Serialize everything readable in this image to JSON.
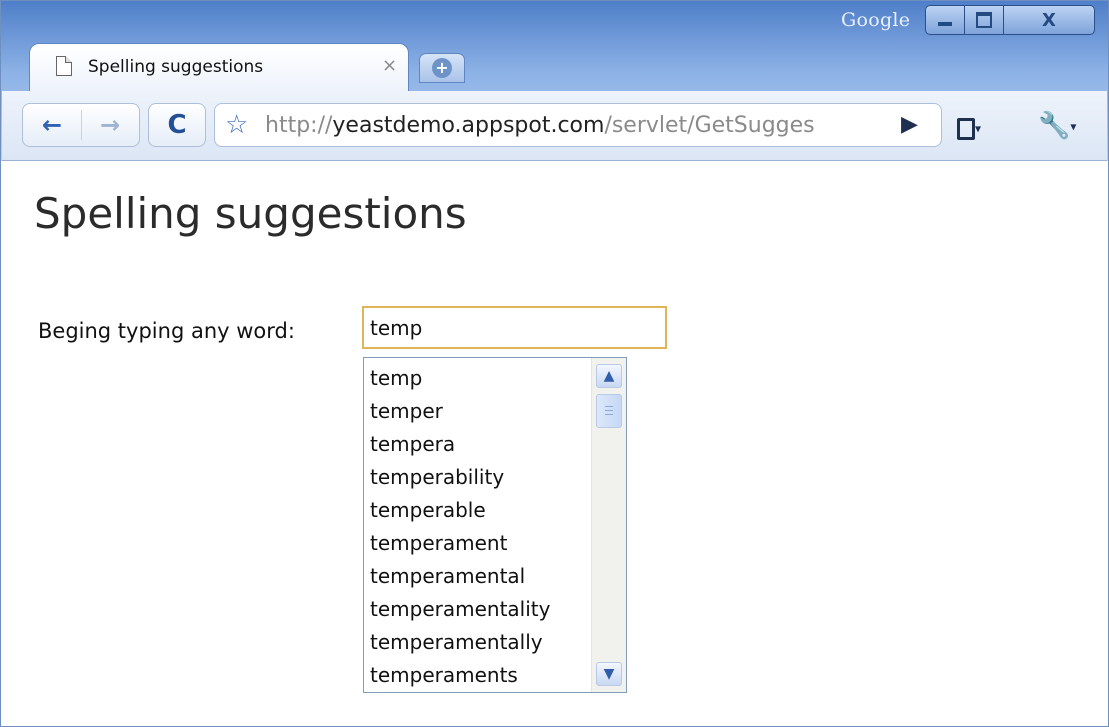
{
  "window": {
    "brand": "Google",
    "controls": {
      "minimize": "–",
      "maximize": "□",
      "close": "X"
    }
  },
  "tab": {
    "title": "Spelling suggestions",
    "close": "×"
  },
  "new_tab": "+",
  "toolbar": {
    "back": "←",
    "forward": "→",
    "reload": "C",
    "star": "☆",
    "url_scheme": "http://",
    "url_host": "yeastdemo.appspot.com",
    "url_path": "/servlet/GetSugges",
    "go": "▶",
    "dropdown": "▾",
    "wrench": "🔧"
  },
  "page": {
    "heading": "Spelling suggestions",
    "field_label": "Beging typing any word:",
    "input_value": "temp",
    "suggestions": [
      "temp",
      "temper",
      "tempera",
      "temperability",
      "temperable",
      "temperament",
      "temperamental",
      "temperamentality",
      "temperamentally",
      "temperaments"
    ],
    "scroll_up": "▲",
    "scroll_down": "▼"
  },
  "colors": {
    "frame": "#6a97d8",
    "input_focus": "#e0b55a",
    "accent": "#2f63b3"
  }
}
